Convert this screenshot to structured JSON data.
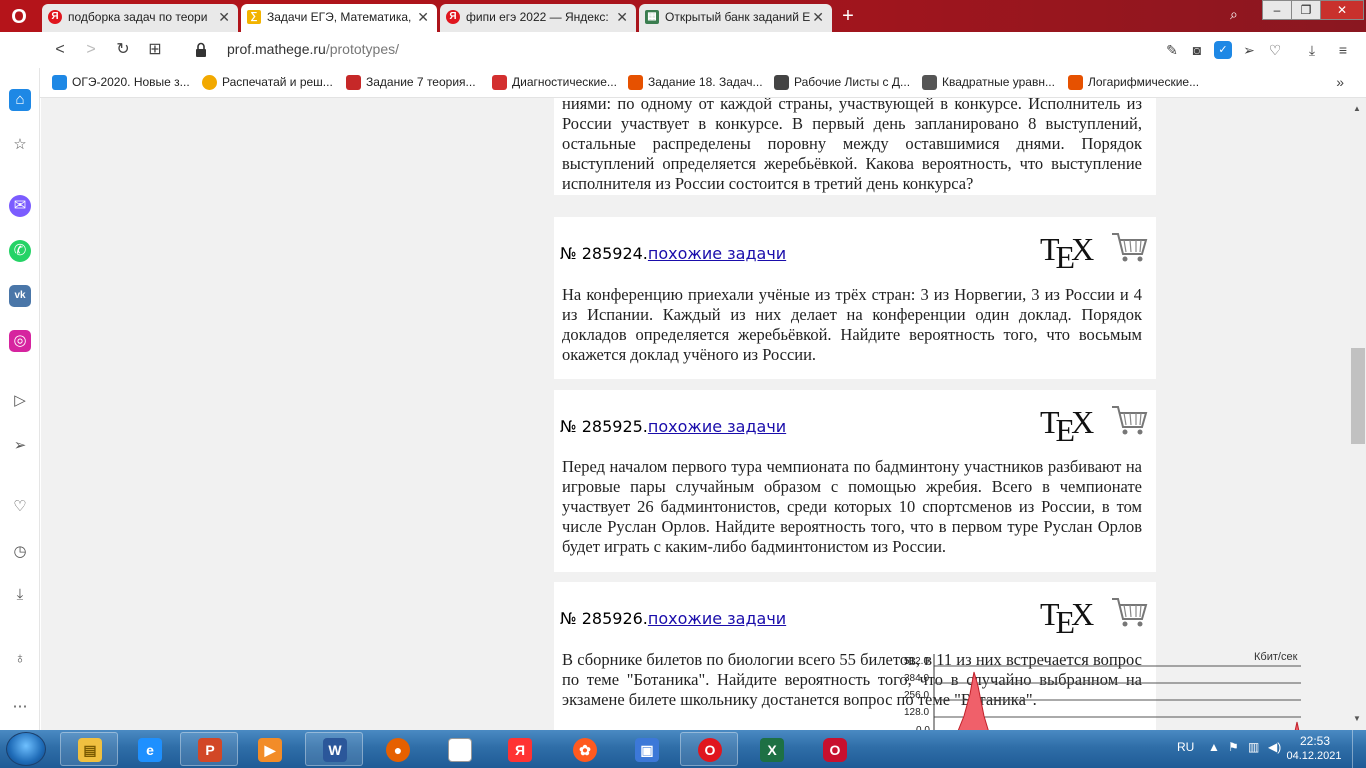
{
  "browser": {
    "tabs": [
      {
        "title": "подборка задач по теори",
        "icon": "yandex-icon"
      },
      {
        "title": "Задачи ЕГЭ, Математика, ",
        "icon": "mathege-icon",
        "active": true
      },
      {
        "title": "фипи егэ 2022 — Яндекс:",
        "icon": "yandex-icon"
      },
      {
        "title": "Открытый банк заданий Е",
        "icon": "fipi-icon"
      }
    ],
    "url_domain": "prof.mathege.ru",
    "url_path": "/prototypes/",
    "bookmarks": [
      {
        "label": "ОГЭ-2020. Новые з...",
        "icon": "book-icon",
        "color": "#1e88e5"
      },
      {
        "label": "Распечатай и реш...",
        "icon": "clock-icon",
        "color": "#f2a900"
      },
      {
        "label": "Задание 7 теория...",
        "icon": "ege-icon",
        "color": "#c62828"
      },
      {
        "label": "Диагностические...",
        "icon": "mob-icon",
        "color": "#d32f2f"
      },
      {
        "label": "Задание 18. Задач...",
        "icon": "ege-icon",
        "color": "#e65100"
      },
      {
        "label": "Рабочие Листы с Д...",
        "icon": "puzzle-icon",
        "color": "#444444"
      },
      {
        "label": "Квадратные уравн...",
        "icon": "grid-icon",
        "color": "#555555"
      },
      {
        "label": "Логарифмические...",
        "icon": "ege-icon",
        "color": "#e65100"
      }
    ]
  },
  "tasks": [
    {
      "text": "ниями: по одному от каждой страны, участвующей в конкурсе. Исполнитель из России участвует в конкурсе. В первый день запланировано 8 выступлений, остальные распределены поровну между оставшимися днями. Порядок выступлений определяется жеребьёвкой. Какова вероятность, что выступление исполнителя из России состоится в третий день конкурса?"
    },
    {
      "number": "№ 285924.",
      "link": "похожие задачи",
      "text": "На конференцию приехали учёные из трёх стран: 3 из Норвегии, 3 из России и 4 из Испании. Каждый из них делает на конференции один доклад. Порядок докладов определяется жеребьёвкой. Найдите вероятность того, что восьмым окажется доклад учёного из России."
    },
    {
      "number": "№ 285925.",
      "link": "похожие задачи",
      "text": "Перед началом первого тура чемпионата по бадминтону участников разбивают на игровые пары случайным образом с помощью жребия. Всего в чемпионате участвует 26 бадминтонистов, среди которых 10 спортсменов из России, в том числе Руслан Орлов. Найдите вероятность того, что в первом туре Руслан Орлов будет играть с каким-либо бадминтонистом из России."
    },
    {
      "number": "№ 285926.",
      "link": "похожие задачи",
      "text": "В сборнике билетов по биологии всего 55 билетов, в 11 из них встречается вопрос по теме \"Ботаника\". Найдите вероятность того, что в случайно выбранном на экзамене билете школьнику достанется вопрос по теме \"Ботаника\"."
    }
  ],
  "tex_label": {
    "t": "T",
    "e": "E",
    "x": "X"
  },
  "netmon": {
    "unit": "Кбит/сек",
    "ticks": [
      "512.0",
      "384.0",
      "256.0",
      "128.0",
      "0.0"
    ]
  },
  "taskbar": {
    "lang": "RU",
    "time": "22:53",
    "date": "04.12.2021",
    "apps": [
      {
        "name": "explorer",
        "color": "#f0c040",
        "glyph": "▤"
      },
      {
        "name": "ie",
        "color": "#1e90ff",
        "glyph": "e"
      },
      {
        "name": "powerpoint",
        "color": "#d24726",
        "glyph": "P"
      },
      {
        "name": "media",
        "color": "#f28c28",
        "glyph": "▶"
      },
      {
        "name": "word",
        "color": "#2b579a",
        "glyph": "W"
      },
      {
        "name": "firefox",
        "color": "#e66000",
        "glyph": "●"
      },
      {
        "name": "file",
        "color": "#ffffff",
        "glyph": ""
      },
      {
        "name": "yandex",
        "color": "#ff3333",
        "glyph": "Я"
      },
      {
        "name": "reel",
        "color": "#ff5a1f",
        "glyph": "✿"
      },
      {
        "name": "app",
        "color": "#3c78d8",
        "glyph": "▣"
      },
      {
        "name": "opera",
        "color": "#e0161e",
        "glyph": "O"
      },
      {
        "name": "excel",
        "color": "#1d7044",
        "glyph": "X"
      },
      {
        "name": "opera-gx",
        "color": "#c8102e",
        "glyph": "O"
      }
    ]
  }
}
